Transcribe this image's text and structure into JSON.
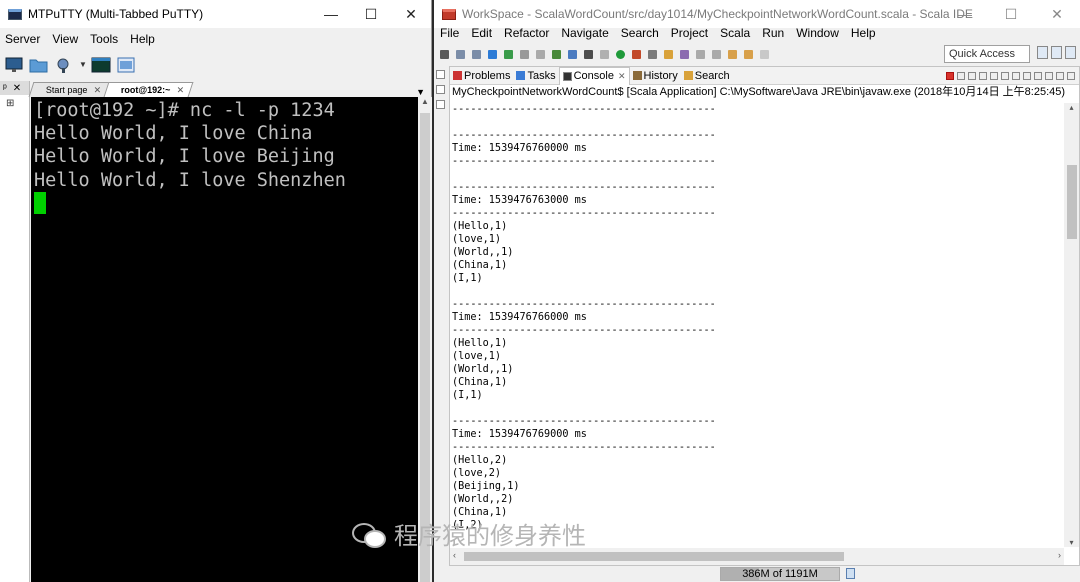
{
  "putty": {
    "title": "MTPuTTY (Multi-Tabbed PuTTY)",
    "window_controls": [
      "—",
      "☐",
      "✕"
    ],
    "menu": [
      "Server",
      "View",
      "Tools",
      "Help"
    ],
    "side_header": [
      "ᵖ",
      "✕"
    ],
    "tree_toggle": "⊞",
    "tabs": [
      {
        "label": "Start page",
        "close": "✕"
      },
      {
        "label": "root@192:~",
        "close": "✕"
      }
    ],
    "tab_menu": "▼",
    "terminal_lines": [
      "[root@192 ~]# nc -l -p 1234",
      "Hello World, I love China",
      "Hello World, I love Beijing",
      "Hello World, I love Shenzhen"
    ],
    "scroll_up": "▲"
  },
  "ide": {
    "title": "WorkSpace - ScalaWordCount/src/day1014/MyCheckpointNetworkWordCount.scala - Scala IDE",
    "window_controls": [
      "—",
      "☐",
      "✕"
    ],
    "menu": [
      "File",
      "Edit",
      "Refactor",
      "Navigate",
      "Search",
      "Project",
      "Scala",
      "Run",
      "Window",
      "Help"
    ],
    "quick_access": "Quick Access",
    "view_tabs": [
      {
        "label": "Problems",
        "active": false
      },
      {
        "label": "Tasks",
        "active": false
      },
      {
        "label": "Console",
        "active": true,
        "close": "✕"
      },
      {
        "label": "History",
        "active": false
      },
      {
        "label": "Search",
        "active": false
      }
    ],
    "launch_description": "MyCheckpointNetworkWordCount$ [Scala Application] C:\\MySoftware\\Java JRE\\bin\\javaw.exe (2018年10月14日 上午8:25:45)",
    "console_lines": [
      "-------------------------------------------",
      "",
      "-------------------------------------------",
      "Time: 1539476760000 ms",
      "-------------------------------------------",
      "",
      "-------------------------------------------",
      "Time: 1539476763000 ms",
      "-------------------------------------------",
      "(Hello,1)",
      "(love,1)",
      "(World,,1)",
      "(China,1)",
      "(I,1)",
      "",
      "-------------------------------------------",
      "Time: 1539476766000 ms",
      "-------------------------------------------",
      "(Hello,1)",
      "(love,1)",
      "(World,,1)",
      "(China,1)",
      "(I,1)",
      "",
      "-------------------------------------------",
      "Time: 1539476769000 ms",
      "-------------------------------------------",
      "(Hello,2)",
      "(love,2)",
      "(Beijing,1)",
      "(World,,2)",
      "(China,1)",
      "(I,2)",
      "",
      "-------------------------------------------"
    ],
    "scroll_up": "▴",
    "scroll_down": "▾",
    "scroll_left": "‹",
    "scroll_right": "›",
    "heap_status": "386M of 1191M",
    "heap_used_fraction": 0.32
  },
  "watermark": "程序猿的修身养性"
}
